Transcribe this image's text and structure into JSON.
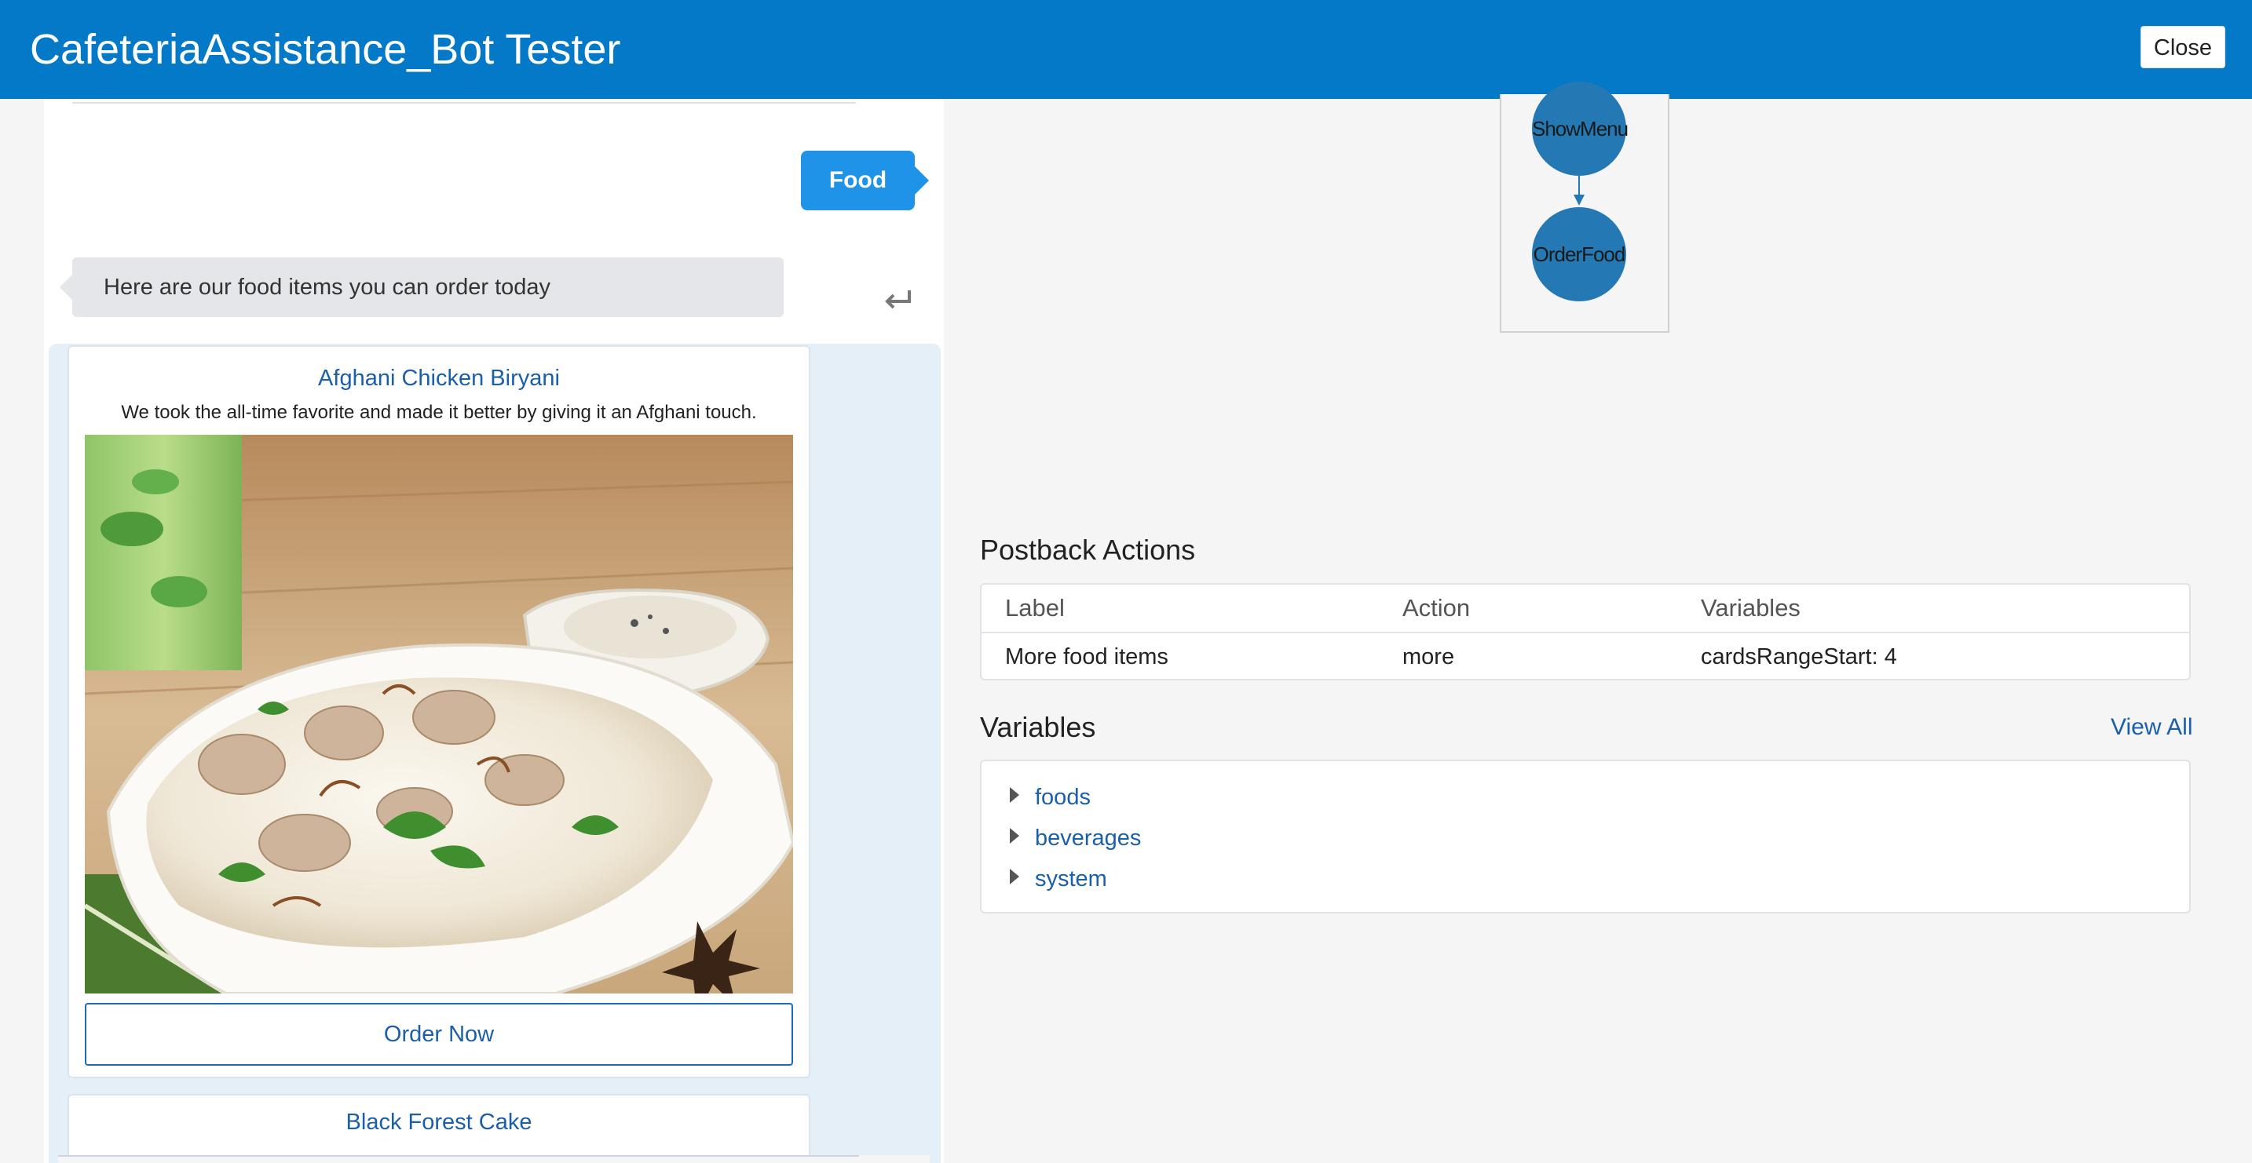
{
  "header": {
    "title": "CafeteriaAssistance_Bot Tester",
    "close_label": "Close"
  },
  "chat": {
    "user_message": "Food",
    "bot_message": "Here are our food items you can order today",
    "cards": [
      {
        "title": "Afghani Chicken Biryani",
        "description": "We took the all-time favorite and made it better by giving it an Afghani touch.",
        "button": "Order Now"
      },
      {
        "title": "Black Forest Cake"
      }
    ]
  },
  "flow": {
    "nodes": [
      "ShowMenu",
      "OrderFood"
    ]
  },
  "postback": {
    "title": "Postback Actions",
    "columns": [
      "Label",
      "Action",
      "Variables"
    ],
    "rows": [
      {
        "label": "More food items",
        "action": "more",
        "variables": "cardsRangeStart: 4"
      }
    ]
  },
  "variables": {
    "title": "Variables",
    "view_all": "View All",
    "items": [
      "foods",
      "beverages",
      "system"
    ]
  },
  "colors": {
    "header": "#0479c8",
    "user_bubble": "#1f93e8",
    "link": "#1a5fa8",
    "node": "#2478b4"
  }
}
